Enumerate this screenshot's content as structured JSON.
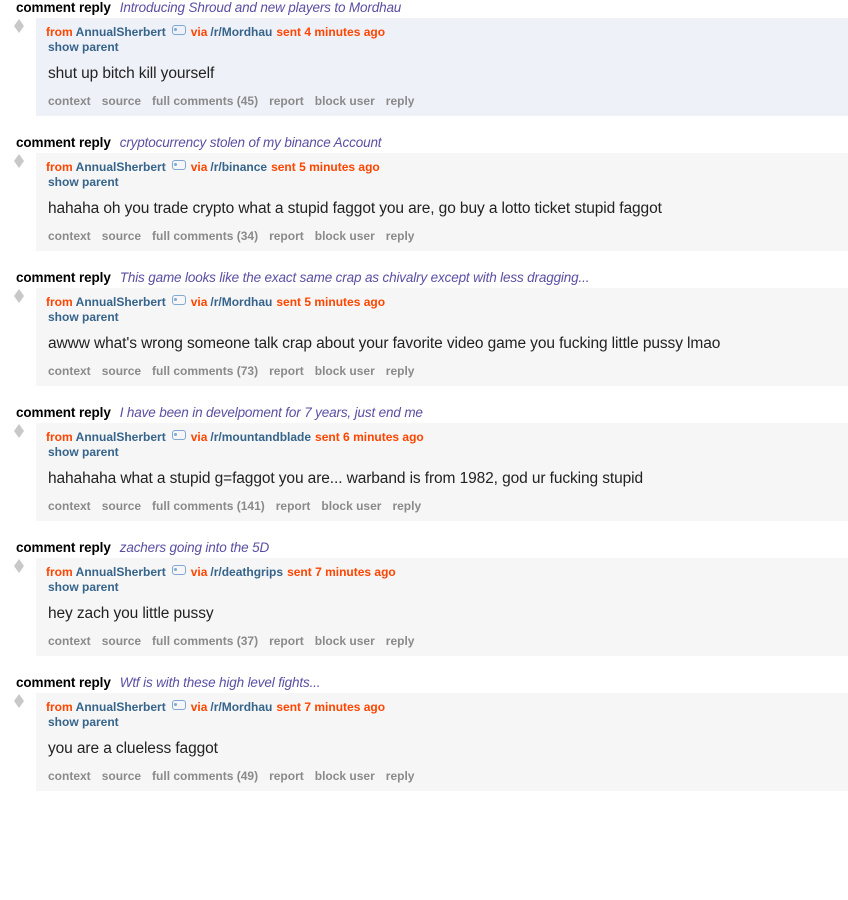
{
  "labels": {
    "kind": "comment reply",
    "from": "from",
    "via": "via",
    "show_parent": "show parent",
    "context": "context",
    "source": "source",
    "report": "report",
    "block_user": "block user",
    "reply": "reply"
  },
  "colors": {
    "orange": "#ff4500",
    "steel_blue": "#36648b",
    "subject_purple": "#5a4fa3",
    "unread_background": "#eff1f8",
    "read_background": "#f6f6f6",
    "action_grey": "#8a8a8a"
  },
  "messages": [
    {
      "kind": "comment reply",
      "subject": "Introducing Shroud and new players to Mordhau",
      "author": "AnnualSherbert",
      "subreddit": "/r/Mordhau",
      "sent": "sent 4 minutes ago",
      "text": "shut up bitch kill yourself",
      "full_comments": "full comments (45)",
      "unread": true
    },
    {
      "kind": "comment reply",
      "subject": "cryptocurrency stolen of my binance Account",
      "author": "AnnualSherbert",
      "subreddit": "/r/binance",
      "sent": "sent 5 minutes ago",
      "text": "hahaha oh you trade crypto what a stupid faggot you are, go buy a lotto ticket stupid faggot",
      "full_comments": "full comments (34)",
      "unread": false
    },
    {
      "kind": "comment reply",
      "subject": "This game looks like the exact same crap as chivalry except with less dragging...",
      "author": "AnnualSherbert",
      "subreddit": "/r/Mordhau",
      "sent": "sent 5 minutes ago",
      "text": "awww what's wrong someone talk crap about your favorite video game you fucking little pussy lmao",
      "full_comments": "full comments (73)",
      "unread": false
    },
    {
      "kind": "comment reply",
      "subject": "I have been in develpoment for 7 years, just end me",
      "author": "AnnualSherbert",
      "subreddit": "/r/mountandblade",
      "sent": "sent 6 minutes ago",
      "text": "hahahaha what a stupid g=faggot you are... warband is from 1982, god ur fucking stupid",
      "full_comments": "full comments (141)",
      "unread": false
    },
    {
      "kind": "comment reply",
      "subject": "zachers going into the 5D",
      "author": "AnnualSherbert",
      "subreddit": "/r/deathgrips",
      "sent": "sent 7 minutes ago",
      "text": "hey zach you little pussy",
      "full_comments": "full comments (37)",
      "unread": false
    },
    {
      "kind": "comment reply",
      "subject": "Wtf is with these high level fights...",
      "author": "AnnualSherbert",
      "subreddit": "/r/Mordhau",
      "sent": "sent 7 minutes ago",
      "text": "you are a clueless faggot",
      "full_comments": "full comments (49)",
      "unread": false
    }
  ]
}
